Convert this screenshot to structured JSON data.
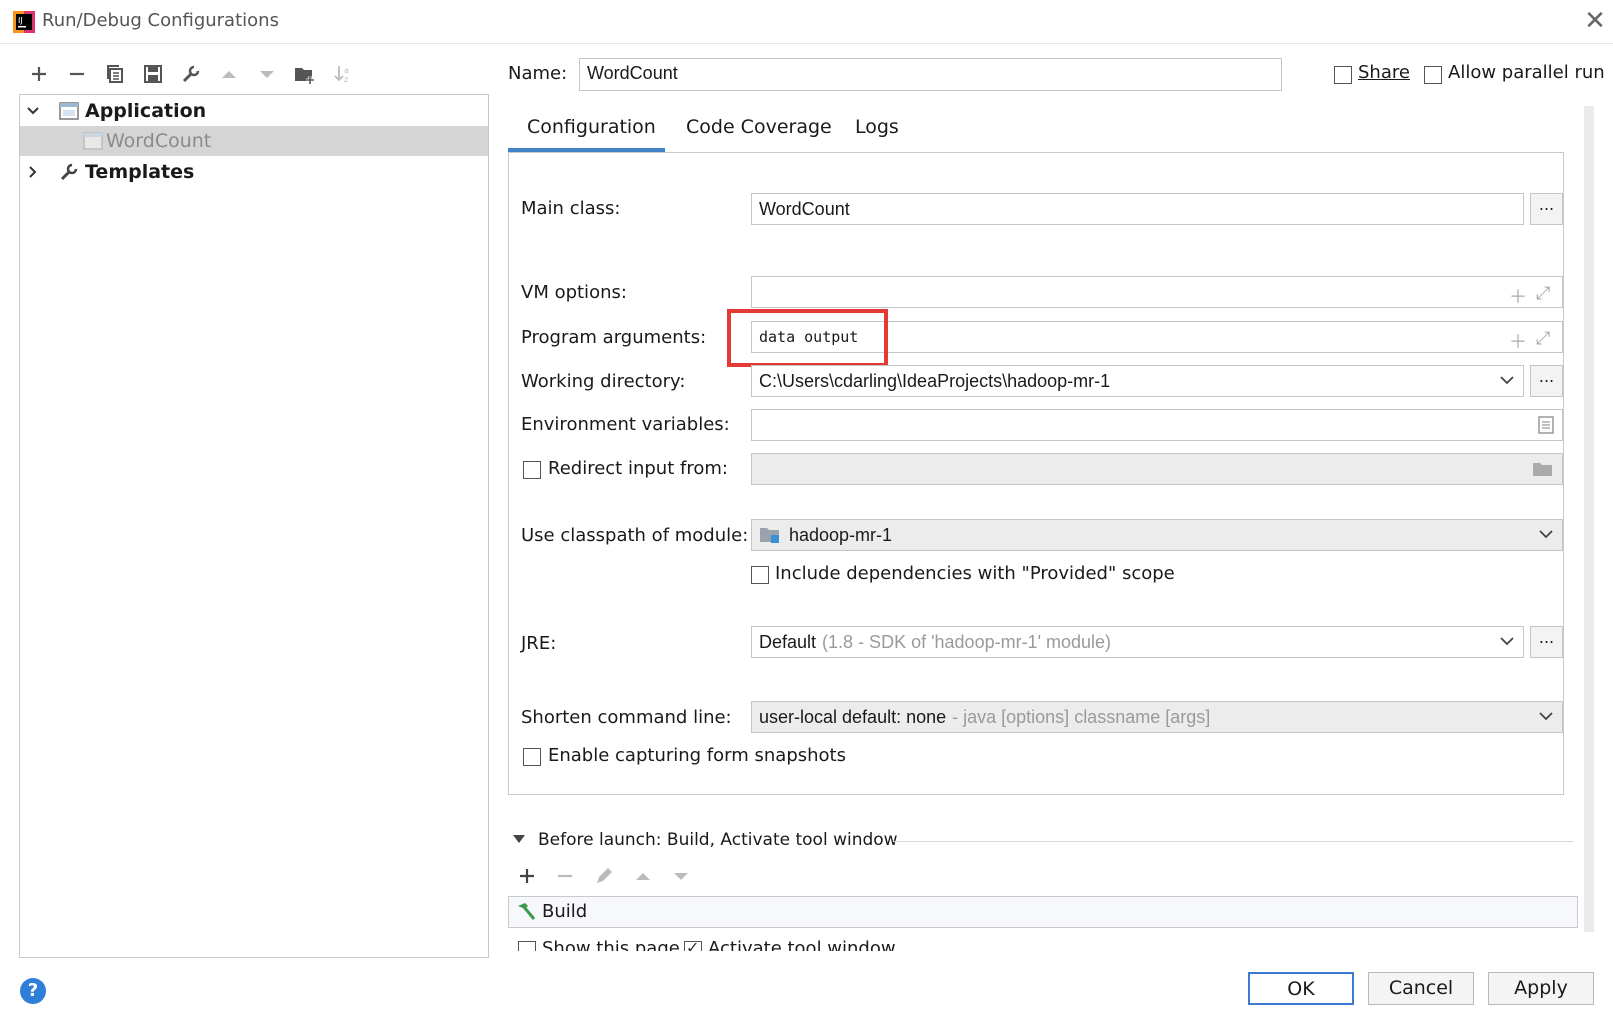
{
  "window": {
    "title": "Run/Debug Configurations"
  },
  "tree": {
    "application": "Application",
    "wordcount": "WordCount",
    "templates": "Templates"
  },
  "name": {
    "label": "Name:",
    "value": "WordCount"
  },
  "share": {
    "label": "Share",
    "checked": false
  },
  "parallel": {
    "label": "Allow parallel run",
    "checked": false
  },
  "tabs": [
    {
      "label": "Configuration",
      "active": true
    },
    {
      "label": "Code Coverage",
      "active": false
    },
    {
      "label": "Logs",
      "active": false
    }
  ],
  "config": {
    "main_class_label": "Main class:",
    "main_class_value": "WordCount",
    "vm_options_label": "VM options:",
    "vm_options_value": "",
    "program_args_label": "Program arguments:",
    "program_args_value": "data output",
    "working_dir_label": "Working directory:",
    "working_dir_value": "C:\\Users\\cdarling\\IdeaProjects\\hadoop-mr-1",
    "env_vars_label": "Environment variables:",
    "redirect_label": "Redirect input from:",
    "classpath_label": "Use classpath of module:",
    "classpath_value": "hadoop-mr-1",
    "include_deps_label": "Include dependencies with \"Provided\" scope",
    "jre_label": "JRE:",
    "jre_value": "Default",
    "jre_hint": "(1.8 - SDK of 'hadoop-mr-1' module)",
    "shorten_label": "Shorten command line:",
    "shorten_value": "user-local default: none",
    "shorten_hint": "- java [options] classname [args]",
    "snapshots_label": "Enable capturing form snapshots",
    "dots": "..."
  },
  "before_launch": {
    "title": "Before launch: Build, Activate tool window",
    "build": "Build",
    "show_page": "Show this page",
    "activate": "Activate tool window"
  },
  "buttons": {
    "ok": "OK",
    "cancel": "Cancel",
    "apply": "Apply",
    "help": "?"
  },
  "colors": {
    "accent": "#4083c9",
    "highlight": "#e53935",
    "selection": "#d5d5d5"
  }
}
